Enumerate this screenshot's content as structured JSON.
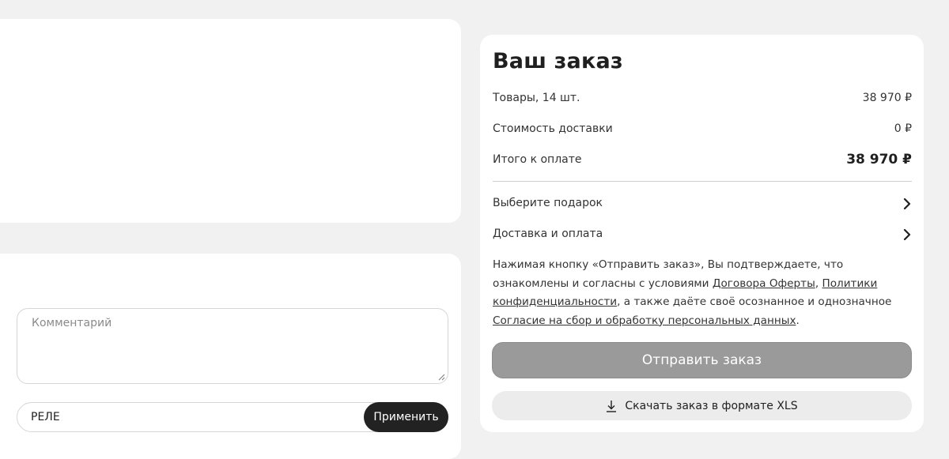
{
  "left_panel": {
    "comment": {
      "placeholder": "Комментарий"
    },
    "promo": {
      "value": "РЕЛЕ",
      "apply_label": "Применить"
    }
  },
  "summary": {
    "title": "Ваш заказ",
    "rows": [
      {
        "label": "Товары, 14 шт.",
        "value": "38 970 ₽"
      },
      {
        "label": "Стоимость доставки",
        "value": "0 ₽"
      },
      {
        "label": "Итого к оплате",
        "value": "38 970 ₽"
      }
    ],
    "links": [
      {
        "label": "Выберите подарок",
        "icon": "chevron-right-icon"
      },
      {
        "label": "Доставка и оплата",
        "icon": "chevron-right-icon"
      }
    ],
    "legal": {
      "text_1": "Нажимая кнопку «Отправить заказ», Вы подтверждаете, что ознакомлены и согласны с условиями ",
      "link_offer": "Договора Оферты",
      "sep": ", ",
      "link_privacy": "Политики конфиденциальности",
      "text_2": ", а также даёте своё осознанное и однозначное ",
      "link_consent": "Согласие на сбор и обработку персональных данных",
      "text_end": "."
    },
    "send_label": "Отправить заказ",
    "xls_label": "Скачать заказ в формате XLS",
    "xls_icon": "download-icon"
  },
  "colors": {
    "background": "#f1f1f1",
    "card": "#ffffff",
    "send_button": "#9a9a9a",
    "apply_button": "#222222",
    "xls_button": "#ececec"
  }
}
